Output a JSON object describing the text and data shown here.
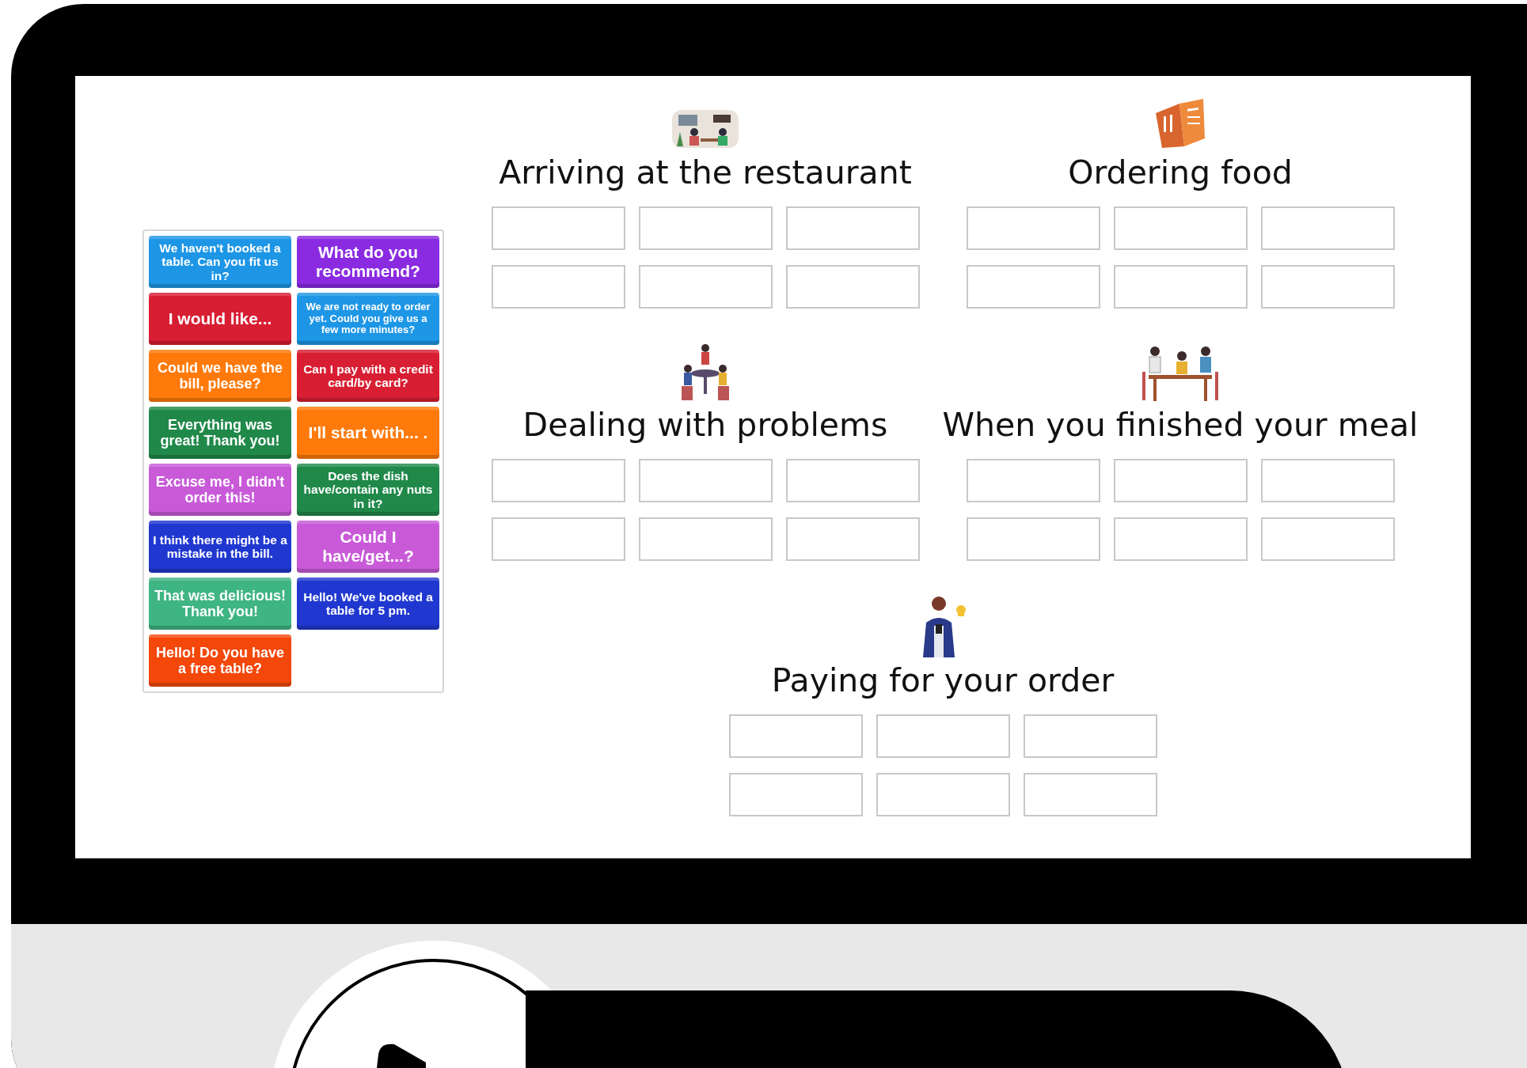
{
  "cards": [
    {
      "text": "We haven't booked a table. Can you fit us in?",
      "color": "#1e96e6"
    },
    {
      "text": "I would like...",
      "color": "#d81e32"
    },
    {
      "text": "Could we have the bill, please?",
      "color": "#ff7a0a"
    },
    {
      "text": "Everything was great! Thank you!",
      "color": "#20894a"
    },
    {
      "text": "Excuse me, I didn't order this!",
      "color": "#c85ad8"
    },
    {
      "text": "I think there might be a mistake in the bill.",
      "color": "#2038d0"
    },
    {
      "text": "That was delicious! Thank you!",
      "color": "#3fb583"
    },
    {
      "text": "Hello! Do you have a free table?",
      "color": "#f4470a"
    },
    {
      "text": "What do you recommend?",
      "color": "#8a2be2"
    },
    {
      "text": "We are not ready to order yet. Could you give us a few more minutes?",
      "color": "#1e96e6"
    },
    {
      "text": "Can I pay with a credit card/by card?",
      "color": "#d81e32"
    },
    {
      "text": "I'll start with... .",
      "color": "#ff7a0a"
    },
    {
      "text": "Does the dish have/contain any nuts in it?",
      "color": "#20894a"
    },
    {
      "text": "Could I have/get...?",
      "color": "#c85ad8"
    },
    {
      "text": "Hello! We've booked a table for 5 pm.",
      "color": "#2038d0"
    }
  ],
  "categories": [
    {
      "title": "Arriving at the restaurant"
    },
    {
      "title": "Ordering food"
    },
    {
      "title": "Dealing with problems"
    },
    {
      "title": "When you finished your meal"
    },
    {
      "title": "Paying for your order"
    }
  ]
}
